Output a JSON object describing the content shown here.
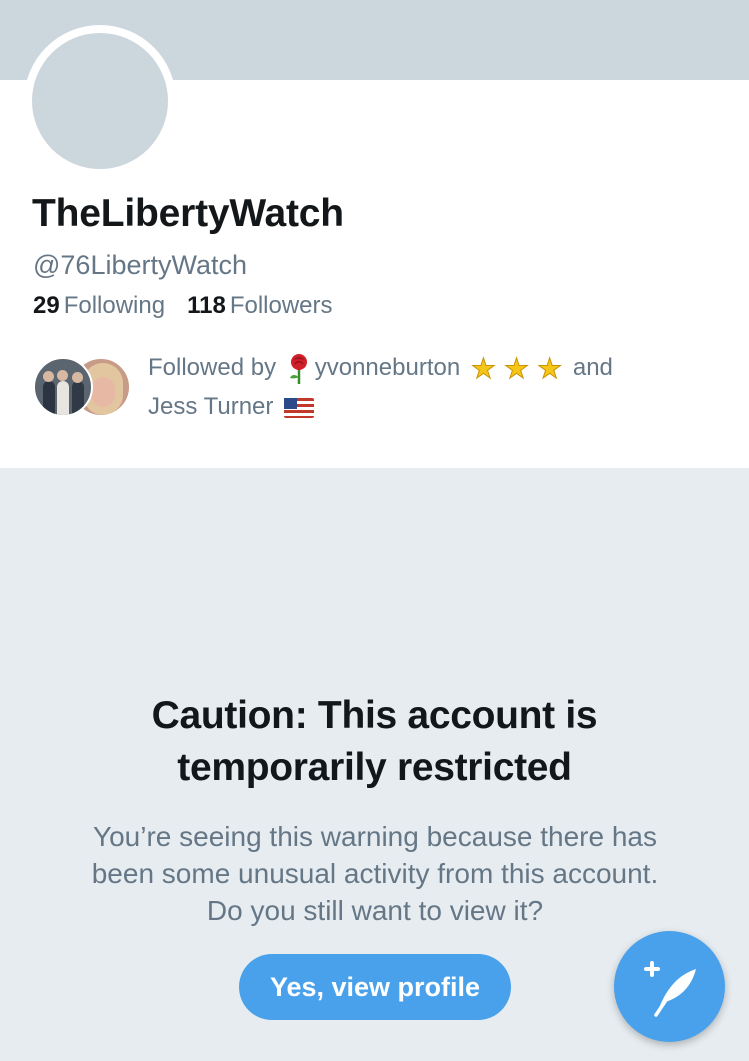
{
  "profile": {
    "display_name": "TheLibertyWatch",
    "handle": "@76LibertyWatch",
    "following_count": "29",
    "following_label": "Following",
    "followers_count": "118",
    "followers_label": "Followers"
  },
  "followed_by": {
    "prefix": "Followed by",
    "first_name": "yvonneburton",
    "conjunction": "and",
    "second_name": "Jess Turner",
    "icons": [
      "rose-emoji",
      "star-emoji",
      "star-emoji",
      "star-emoji",
      "us-flag-emoji"
    ]
  },
  "caution": {
    "title": "Caution: This account is temporarily restricted",
    "body": "You’re seeing this warning because there has been some unusual activity from this account. Do you still want to view it?",
    "button_label": "Yes, view profile"
  },
  "colors": {
    "accent": "#4aa1eb",
    "banner": "#ccd6dd",
    "background": "#e6ecf0",
    "secondary_text": "#657786",
    "primary_text": "#14171a"
  }
}
